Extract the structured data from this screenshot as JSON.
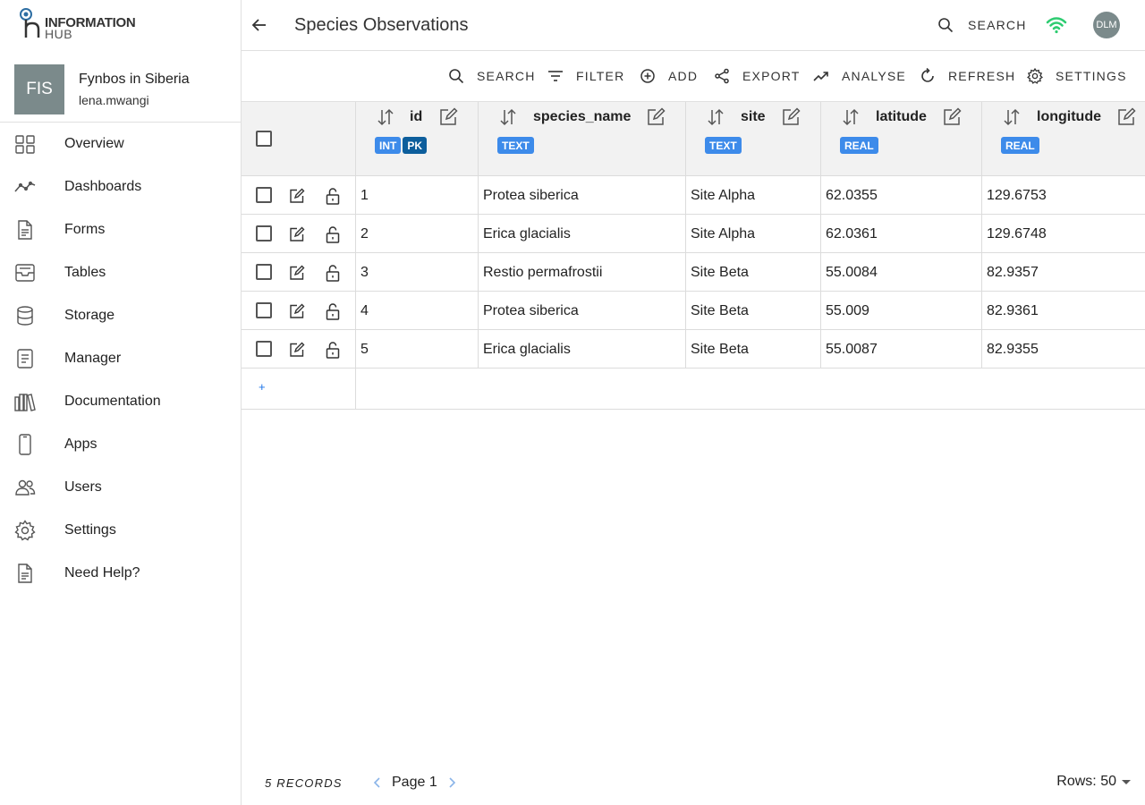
{
  "brand": {
    "logo_line1": "INFORMATION",
    "logo_line2": "HUB"
  },
  "project": {
    "initials": "FIS",
    "name": "Fynbos in Siberia",
    "user": "lena.mwangi"
  },
  "sidebar": {
    "items": [
      {
        "label": "Overview",
        "icon": "grid-icon"
      },
      {
        "label": "Dashboards",
        "icon": "chart-line-icon"
      },
      {
        "label": "Forms",
        "icon": "document-icon"
      },
      {
        "label": "Tables",
        "icon": "inbox-icon"
      },
      {
        "label": "Storage",
        "icon": "database-icon"
      },
      {
        "label": "Manager",
        "icon": "notebook-icon"
      },
      {
        "label": "Documentation",
        "icon": "books-icon"
      },
      {
        "label": "Apps",
        "icon": "phone-icon"
      },
      {
        "label": "Users",
        "icon": "users-icon"
      },
      {
        "label": "Settings",
        "icon": "gear-icon"
      },
      {
        "label": "Need Help?",
        "icon": "help-doc-icon"
      }
    ]
  },
  "header": {
    "title": "Species Observations",
    "search_label": "SEARCH",
    "user_initials": "DLM",
    "wifi_color": "#2ecc71"
  },
  "toolbar": {
    "search": "SEARCH",
    "filter": "FILTER",
    "add": "ADD",
    "export": "EXPORT",
    "analyse": "ANALYSE",
    "refresh": "REFRESH",
    "settings": "SETTINGS"
  },
  "colors": {
    "badge_type": "#3d8bea",
    "badge_pk": "#0d5e9c",
    "link": "#1a73e8"
  },
  "table": {
    "columns": [
      {
        "name": "id",
        "types": [
          "INT",
          "PK"
        ]
      },
      {
        "name": "species_name",
        "types": [
          "TEXT"
        ]
      },
      {
        "name": "site",
        "types": [
          "TEXT"
        ]
      },
      {
        "name": "latitude",
        "types": [
          "REAL"
        ]
      },
      {
        "name": "longitude",
        "types": [
          "REAL"
        ]
      }
    ],
    "rows": [
      [
        "1",
        "Protea siberica",
        "Site Alpha",
        "62.0355",
        "129.6753"
      ],
      [
        "2",
        "Erica glacialis",
        "Site Alpha",
        "62.0361",
        "129.6748"
      ],
      [
        "3",
        "Restio permafrostii",
        "Site Beta",
        "55.0084",
        "82.9357"
      ],
      [
        "4",
        "Protea siberica",
        "Site Beta",
        "55.009",
        "82.9361"
      ],
      [
        "5",
        "Erica glacialis",
        "Site Beta",
        "55.0087",
        "82.9355"
      ]
    ],
    "add_row": "+"
  },
  "footer": {
    "records": "5 RECORDS",
    "page": "Page 1",
    "rows": "Rows: 50"
  }
}
